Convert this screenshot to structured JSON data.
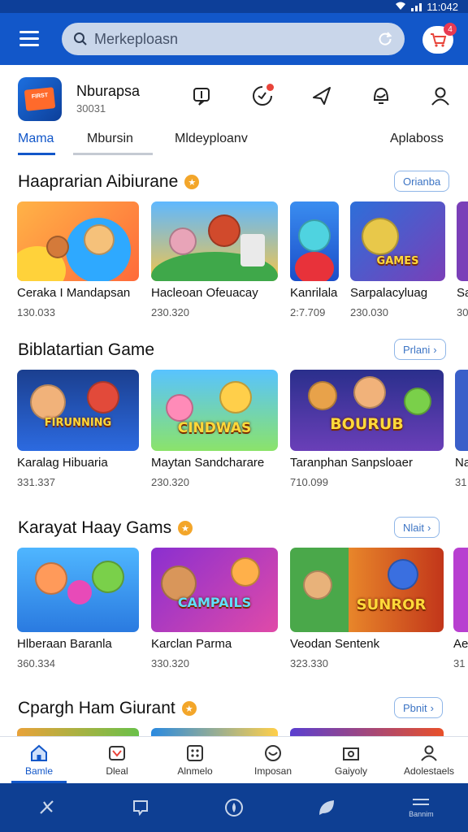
{
  "status_bar": {
    "time": "11:042"
  },
  "search": {
    "placeholder": "Merkeploasn"
  },
  "cart": {
    "badge": "4"
  },
  "profile": {
    "name": "Nburapsa",
    "subtitle": "30031",
    "logo_text": "FIRST"
  },
  "header_icons": [
    "book-icon",
    "timer-icon",
    "send-icon",
    "notification-icon",
    "user-icon"
  ],
  "tabs": [
    {
      "label": "Mama",
      "active": true
    },
    {
      "label": "Mbursin",
      "active": false
    },
    {
      "label": "Mldeyploanv",
      "active": false
    },
    {
      "label": "Aplaboss",
      "active": false
    }
  ],
  "sections": [
    {
      "title": "Haaprarian Aibiurane",
      "has_coin": true,
      "more_label": "Orianba",
      "cards": [
        {
          "title": "Ceraka I Mandapsan",
          "meta": "130.033",
          "art": ""
        },
        {
          "title": "Hacleoan Ofeuacay",
          "meta": "230.320",
          "art": ""
        },
        {
          "title": "Kanrilala",
          "meta": "2:7.709",
          "art": ""
        },
        {
          "title": "Sarpalacyluag",
          "meta": "230.030",
          "art": "GAMES"
        },
        {
          "title": "Sa",
          "meta": "30",
          "art": ""
        }
      ]
    },
    {
      "title": "Biblatartian Game",
      "has_coin": false,
      "more_label": "Prlani",
      "cards": [
        {
          "title": "Karalag Hibuaria",
          "meta": "331.337",
          "art": "FIRUNNING"
        },
        {
          "title": "Maytan Sandcharare",
          "meta": "230.320",
          "art": "CINDWAS"
        },
        {
          "title": "Taranphan Sanpsloaer",
          "meta": "710.099",
          "art": "BOURUB"
        },
        {
          "title": "Na",
          "meta": "31",
          "art": ""
        }
      ]
    },
    {
      "title": "Karayat Haay Gams",
      "has_coin": true,
      "more_label": "Nlait",
      "cards": [
        {
          "title": "Hlberaan Baranla",
          "meta": "360.334",
          "art": ""
        },
        {
          "title": "Karclan Parma",
          "meta": "330.320",
          "art": "CAMPAILS"
        },
        {
          "title": "Veodan Sentenk",
          "meta": "323.330",
          "art": "SUNROR"
        },
        {
          "title": "Ae",
          "meta": "31",
          "art": ""
        }
      ]
    },
    {
      "title": "Cpargh Ham Giurant",
      "has_coin": true,
      "more_label": "Pbnit",
      "cards": []
    }
  ],
  "bottom_nav": [
    {
      "label": "Bamle",
      "icon": "home-icon",
      "active": true
    },
    {
      "label": "Dleal",
      "icon": "deal-icon",
      "active": false
    },
    {
      "label": "Alnmelo",
      "icon": "grid-icon",
      "active": false
    },
    {
      "label": "Imposan",
      "icon": "smile-icon",
      "active": false
    },
    {
      "label": "Gaiyoly",
      "icon": "wallet-icon",
      "active": false
    },
    {
      "label": "Adolestaels",
      "icon": "account-icon",
      "active": false
    }
  ],
  "system_nav": {
    "last_label": "Bannim"
  }
}
